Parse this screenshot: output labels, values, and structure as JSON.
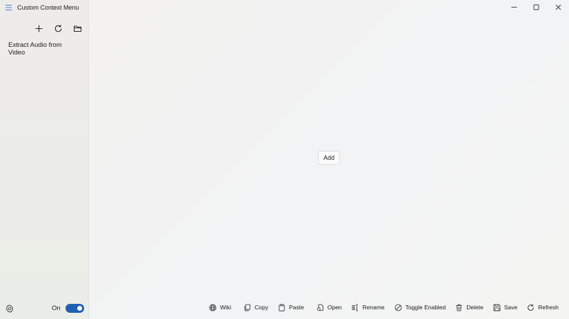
{
  "app": {
    "title": "Custom Context Menu"
  },
  "sidebar": {
    "toolbar": {
      "new_icon": "plus-icon",
      "refresh_icon": "refresh-icon",
      "folder_icon": "folder-icon"
    },
    "items": [
      {
        "label": "Extract Audio from Video"
      }
    ],
    "settings_icon": "gear-icon",
    "toggle": {
      "label": "On",
      "state": true,
      "color": "#1f5fb4"
    }
  },
  "main": {
    "add_label": "Add"
  },
  "commands": [
    {
      "label": "Wiki",
      "icon": "globe-icon"
    },
    {
      "label": "Copy",
      "icon": "copy-icon"
    },
    {
      "label": "Paste",
      "icon": "paste-icon"
    },
    {
      "label": "Open",
      "icon": "open-icon"
    },
    {
      "label": "Rename",
      "icon": "rename-icon"
    },
    {
      "label": "Toggle Enabled",
      "icon": "block-icon"
    },
    {
      "label": "Delete",
      "icon": "trash-icon"
    },
    {
      "label": "Save",
      "icon": "save-icon"
    },
    {
      "label": "Refresh",
      "icon": "refresh-icon"
    }
  ]
}
